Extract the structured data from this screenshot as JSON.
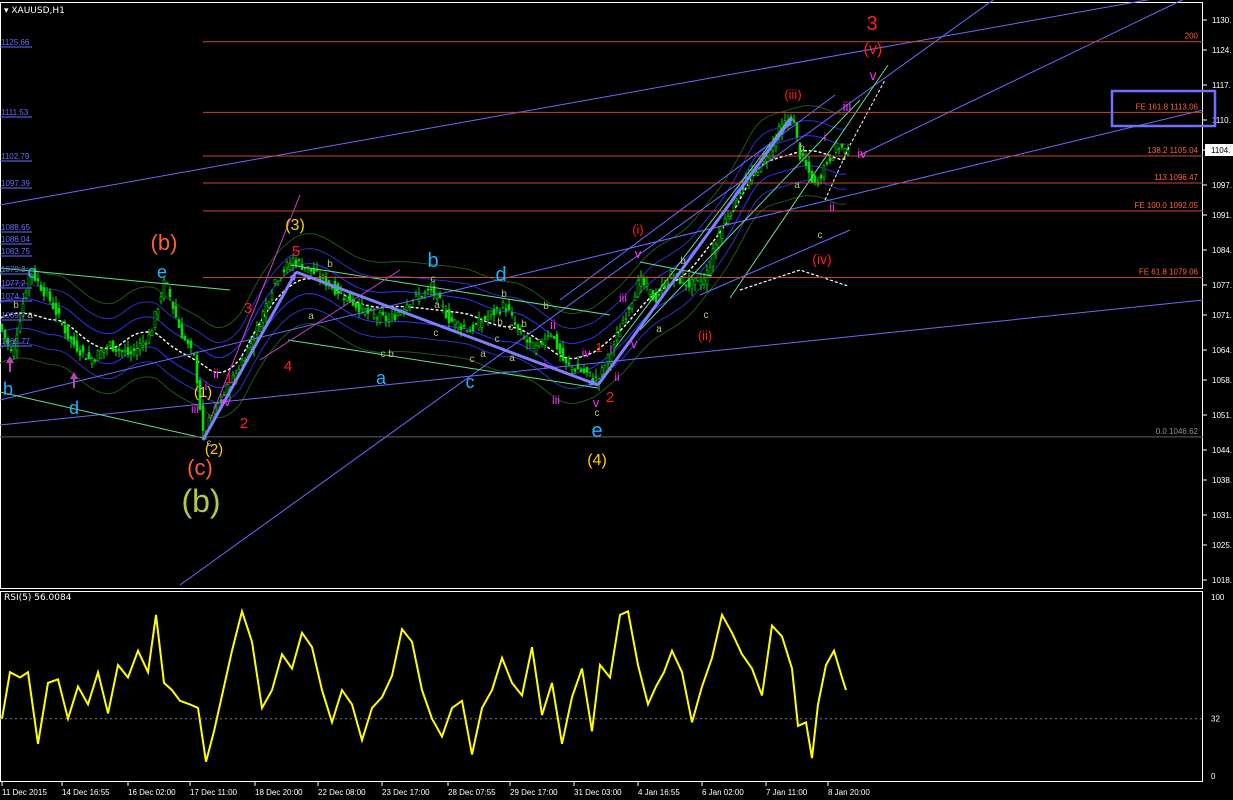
{
  "header": {
    "symbol_label": "XAUUSD,H1",
    "dropdown_icon": "triangle-down-icon"
  },
  "rsi": {
    "label": "RSI(5) 56.0084",
    "axis_ticks": [
      "100",
      "32",
      "0"
    ]
  },
  "colors": {
    "background": "#000000",
    "axis": "#ffffff",
    "candle": "#00e000",
    "rsi_line": "#ffff00",
    "fib_line": "#c84a2a",
    "trend_line": "#6a6aff",
    "impulse_arrow": "#8080ff",
    "annot_red": "#ff2020",
    "annot_orange": "#ff6030",
    "annot_yellow": "#ffd000",
    "annot_cyan": "#1eb4ff",
    "annot_magenta": "#ff30ff",
    "annot_olive": "#b4c840",
    "annot_small_green": "#b4c878",
    "highlight_box": "#7070ff"
  },
  "chart_data": {
    "type": "candlestick",
    "symbol": "XAUUSD",
    "timeframe": "H1",
    "ylim": [
      1016,
      1134
    ],
    "y_ticks": [
      "1130.",
      "1124.",
      "1117.",
      "1110.",
      "1104.",
      "1097.",
      "1091.",
      "1084.",
      "1077.",
      "1071.",
      "1064.",
      "1058.",
      "1051.",
      "1044.",
      "1038.",
      "1031.",
      "1025.",
      "1018."
    ],
    "x_ticks": [
      "11 Dec 2015",
      "14 Dec 16:55",
      "16 Dec 02:00",
      "17 Dec 11:00",
      "18 Dec 20:00",
      "22 Dec 08:00",
      "23 Dec 17:00",
      "28 Dec 07:55",
      "29 Dec 17:00",
      "31 Dec 03:00",
      "4 Jan 16:55",
      "6 Jan 02:00",
      "7 Jan 11:00",
      "8 Jan 20:00"
    ],
    "current_price": "1104.",
    "price_path": [
      [
        0,
        1069
      ],
      [
        12,
        1063
      ],
      [
        30,
        1080
      ],
      [
        50,
        1074
      ],
      [
        70,
        1066
      ],
      [
        90,
        1062
      ],
      [
        110,
        1065
      ],
      [
        130,
        1063
      ],
      [
        150,
        1067
      ],
      [
        165,
        1078
      ],
      [
        180,
        1068
      ],
      [
        195,
        1062
      ],
      [
        203,
        1047
      ],
      [
        215,
        1052
      ],
      [
        235,
        1059
      ],
      [
        255,
        1067
      ],
      [
        275,
        1078
      ],
      [
        293,
        1082
      ],
      [
        310,
        1080
      ],
      [
        330,
        1077
      ],
      [
        350,
        1074
      ],
      [
        370,
        1071
      ],
      [
        390,
        1070
      ],
      [
        410,
        1074
      ],
      [
        432,
        1076
      ],
      [
        450,
        1070
      ],
      [
        470,
        1068
      ],
      [
        490,
        1071
      ],
      [
        505,
        1073
      ],
      [
        520,
        1067
      ],
      [
        535,
        1064
      ],
      [
        550,
        1068
      ],
      [
        565,
        1061
      ],
      [
        580,
        1060
      ],
      [
        598,
        1058
      ],
      [
        612,
        1064
      ],
      [
        625,
        1071
      ],
      [
        640,
        1078
      ],
      [
        655,
        1074
      ],
      [
        670,
        1079
      ],
      [
        690,
        1077
      ],
      [
        705,
        1078
      ],
      [
        720,
        1088
      ],
      [
        740,
        1096
      ],
      [
        760,
        1101
      ],
      [
        780,
        1108
      ],
      [
        792,
        1111
      ],
      [
        800,
        1103
      ],
      [
        815,
        1097
      ],
      [
        825,
        1101
      ],
      [
        838,
        1105
      ],
      [
        850,
        1103
      ]
    ],
    "rsi_path": [
      [
        2,
        32
      ],
      [
        10,
        58
      ],
      [
        20,
        55
      ],
      [
        28,
        58
      ],
      [
        38,
        18
      ],
      [
        48,
        52
      ],
      [
        58,
        54
      ],
      [
        68,
        32
      ],
      [
        78,
        50
      ],
      [
        88,
        40
      ],
      [
        98,
        58
      ],
      [
        108,
        35
      ],
      [
        118,
        62
      ],
      [
        128,
        55
      ],
      [
        138,
        70
      ],
      [
        148,
        58
      ],
      [
        156,
        90
      ],
      [
        164,
        52
      ],
      [
        172,
        48
      ],
      [
        180,
        42
      ],
      [
        190,
        40
      ],
      [
        198,
        38
      ],
      [
        206,
        8
      ],
      [
        214,
        25
      ],
      [
        222,
        45
      ],
      [
        232,
        70
      ],
      [
        242,
        92
      ],
      [
        252,
        75
      ],
      [
        262,
        38
      ],
      [
        272,
        48
      ],
      [
        282,
        68
      ],
      [
        292,
        60
      ],
      [
        302,
        80
      ],
      [
        312,
        72
      ],
      [
        322,
        48
      ],
      [
        332,
        30
      ],
      [
        342,
        48
      ],
      [
        352,
        40
      ],
      [
        362,
        20
      ],
      [
        372,
        38
      ],
      [
        382,
        44
      ],
      [
        392,
        56
      ],
      [
        402,
        82
      ],
      [
        412,
        75
      ],
      [
        422,
        48
      ],
      [
        432,
        32
      ],
      [
        442,
        22
      ],
      [
        452,
        38
      ],
      [
        462,
        42
      ],
      [
        472,
        12
      ],
      [
        482,
        38
      ],
      [
        492,
        48
      ],
      [
        502,
        66
      ],
      [
        512,
        52
      ],
      [
        522,
        45
      ],
      [
        532,
        72
      ],
      [
        542,
        34
      ],
      [
        552,
        52
      ],
      [
        562,
        18
      ],
      [
        572,
        44
      ],
      [
        582,
        60
      ],
      [
        592,
        25
      ],
      [
        600,
        62
      ],
      [
        610,
        55
      ],
      [
        620,
        90
      ],
      [
        628,
        92
      ],
      [
        638,
        62
      ],
      [
        648,
        40
      ],
      [
        656,
        50
      ],
      [
        664,
        58
      ],
      [
        672,
        70
      ],
      [
        682,
        58
      ],
      [
        692,
        30
      ],
      [
        702,
        50
      ],
      [
        712,
        66
      ],
      [
        722,
        90
      ],
      [
        732,
        80
      ],
      [
        742,
        68
      ],
      [
        752,
        60
      ],
      [
        762,
        45
      ],
      [
        772,
        84
      ],
      [
        782,
        78
      ],
      [
        792,
        60
      ],
      [
        798,
        28
      ],
      [
        806,
        30
      ],
      [
        812,
        10
      ],
      [
        818,
        40
      ],
      [
        826,
        62
      ],
      [
        834,
        70
      ],
      [
        842,
        55
      ],
      [
        846,
        48
      ]
    ],
    "fib_levels": [
      {
        "label": "200",
        "value": 1125.66
      },
      {
        "label": "FE 161.8 1113.06",
        "value": 1111.53
      },
      {
        "label": "138.2 1105.04",
        "value": 1102.79
      },
      {
        "label": "113 1096.47",
        "value": 1097.39
      },
      {
        "label": "FE 100.0 1092.05",
        "value": 1091.8
      },
      {
        "label": "FE 61.8 1079.06",
        "value": 1078.5
      },
      {
        "label": "0.0 1046.62",
        "value": 1046.62
      }
    ],
    "left_price_labels": [
      "1125.66",
      "1111.53",
      "1102.79",
      "1097.39",
      "1088.65",
      "1086.04",
      "1083.75",
      "1079.3",
      "1077.2",
      "1074.1",
      "1069.7",
      "1065.77"
    ],
    "wave_labels": [
      {
        "t": "3",
        "c": "annot_red",
        "s": 20
      },
      {
        "t": "(v)",
        "c": "annot_red",
        "s": 16
      },
      {
        "t": "v",
        "c": "annot_magenta",
        "s": 14
      },
      {
        "t": "iii",
        "c": "annot_magenta",
        "s": 13
      },
      {
        "t": "(iii)",
        "c": "annot_red",
        "s": 13
      },
      {
        "t": "i",
        "c": "annot_magenta",
        "s": 12
      },
      {
        "t": "iv",
        "c": "annot_magenta",
        "s": 13
      },
      {
        "t": "b",
        "c": "annot_small_green",
        "s": 10
      },
      {
        "t": "a",
        "c": "annot_small_green",
        "s": 10
      },
      {
        "t": "ii",
        "c": "annot_magenta",
        "s": 12
      },
      {
        "t": "c",
        "c": "annot_small_green",
        "s": 10
      },
      {
        "t": "(iv)",
        "c": "annot_red",
        "s": 14
      },
      {
        "t": "(i)",
        "c": "annot_red",
        "s": 13
      },
      {
        "t": "v",
        "c": "annot_magenta",
        "s": 13
      },
      {
        "t": "iii",
        "c": "annot_magenta",
        "s": 12
      },
      {
        "t": "b",
        "c": "annot_small_green",
        "s": 10
      },
      {
        "t": "a",
        "c": "annot_small_green",
        "s": 10
      },
      {
        "t": "(ii)",
        "c": "annot_red",
        "s": 13
      },
      {
        "t": "c",
        "c": "annot_small_green",
        "s": 10
      },
      {
        "t": "i",
        "c": "annot_magenta",
        "s": 13
      },
      {
        "t": "v",
        "c": "annot_magenta",
        "s": 13
      },
      {
        "t": "ii",
        "c": "annot_magenta",
        "s": 12
      },
      {
        "t": "iv",
        "c": "annot_magenta",
        "s": 12
      },
      {
        "t": "1",
        "c": "annot_red",
        "s": 13
      },
      {
        "t": "v",
        "c": "annot_magenta",
        "s": 13
      },
      {
        "t": "2",
        "c": "annot_red",
        "s": 15
      },
      {
        "t": "c",
        "c": "annot_small_green",
        "s": 10
      },
      {
        "t": "e",
        "c": "annot_cyan",
        "s": 20
      },
      {
        "t": "(4)",
        "c": "annot_yellow",
        "s": 16
      },
      {
        "t": "iii",
        "c": "annot_magenta",
        "s": 12
      },
      {
        "t": "ii",
        "c": "annot_magenta",
        "s": 13
      },
      {
        "t": "i",
        "c": "annot_magenta",
        "s": 12
      },
      {
        "t": "b",
        "c": "annot_small_green",
        "s": 10
      },
      {
        "t": "d",
        "c": "annot_cyan",
        "s": 20
      },
      {
        "t": "b",
        "c": "annot_cyan",
        "s": 20
      },
      {
        "t": "c",
        "c": "annot_small_green",
        "s": 10
      },
      {
        "t": "a",
        "c": "annot_cyan",
        "s": 18
      },
      {
        "t": "c",
        "c": "annot_cyan",
        "s": 18
      },
      {
        "t": "b",
        "c": "annot_small_green",
        "s": 10
      },
      {
        "t": "a",
        "c": "annot_small_green",
        "s": 10
      },
      {
        "t": "c",
        "c": "annot_small_green",
        "s": 10
      },
      {
        "t": "b",
        "c": "annot_small_green",
        "s": 10
      },
      {
        "t": "c",
        "c": "annot_small_green",
        "s": 10
      },
      {
        "t": "a",
        "c": "annot_small_green",
        "s": 10
      },
      {
        "t": "c",
        "c": "annot_small_green",
        "s": 10
      },
      {
        "t": "a",
        "c": "annot_small_green",
        "s": 10
      },
      {
        "t": "c",
        "c": "annot_small_green",
        "s": 10
      },
      {
        "t": "b",
        "c": "annot_small_green",
        "s": 10
      },
      {
        "t": "a",
        "c": "annot_small_green",
        "s": 10
      },
      {
        "t": "c",
        "c": "annot_small_green",
        "s": 10
      },
      {
        "t": "b",
        "c": "annot_small_green",
        "s": 10
      },
      {
        "t": "b",
        "c": "annot_small_green",
        "s": 10
      },
      {
        "t": "(3)",
        "c": "annot_yellow",
        "s": 16
      },
      {
        "t": "5",
        "c": "annot_red",
        "s": 15
      },
      {
        "t": "3",
        "c": "annot_red",
        "s": 15
      },
      {
        "t": "4",
        "c": "annot_red",
        "s": 15
      },
      {
        "t": "1",
        "c": "annot_red",
        "s": 14
      },
      {
        "t": "(1)",
        "c": "annot_yellow",
        "s": 15
      },
      {
        "t": "2",
        "c": "annot_red",
        "s": 15
      },
      {
        "t": "(2)",
        "c": "annot_yellow",
        "s": 15
      },
      {
        "t": "(c)",
        "c": "annot_orange",
        "s": 22
      },
      {
        "t": "(b)",
        "c": "annot_olive",
        "s": 32
      },
      {
        "t": "(b)",
        "c": "annot_orange",
        "s": 22
      },
      {
        "t": "e",
        "c": "annot_cyan",
        "s": 18
      },
      {
        "t": "c",
        "c": "annot_cyan",
        "s": 18
      },
      {
        "t": "b",
        "c": "annot_cyan",
        "s": 18
      },
      {
        "t": "d",
        "c": "annot_cyan",
        "s": 18
      },
      {
        "t": "b",
        "c": "annot_small_green",
        "s": 10
      },
      {
        "t": "a",
        "c": "annot_small_green",
        "s": 10
      },
      {
        "t": "ii",
        "c": "annot_magenta",
        "s": 13
      },
      {
        "t": "iv",
        "c": "annot_magenta",
        "s": 13
      },
      {
        "t": "iii",
        "c": "annot_magenta",
        "s": 12
      },
      {
        "t": "i",
        "c": "annot_magenta",
        "s": 12
      },
      {
        "t": "c",
        "c": "annot_small_green",
        "s": 10
      }
    ]
  }
}
